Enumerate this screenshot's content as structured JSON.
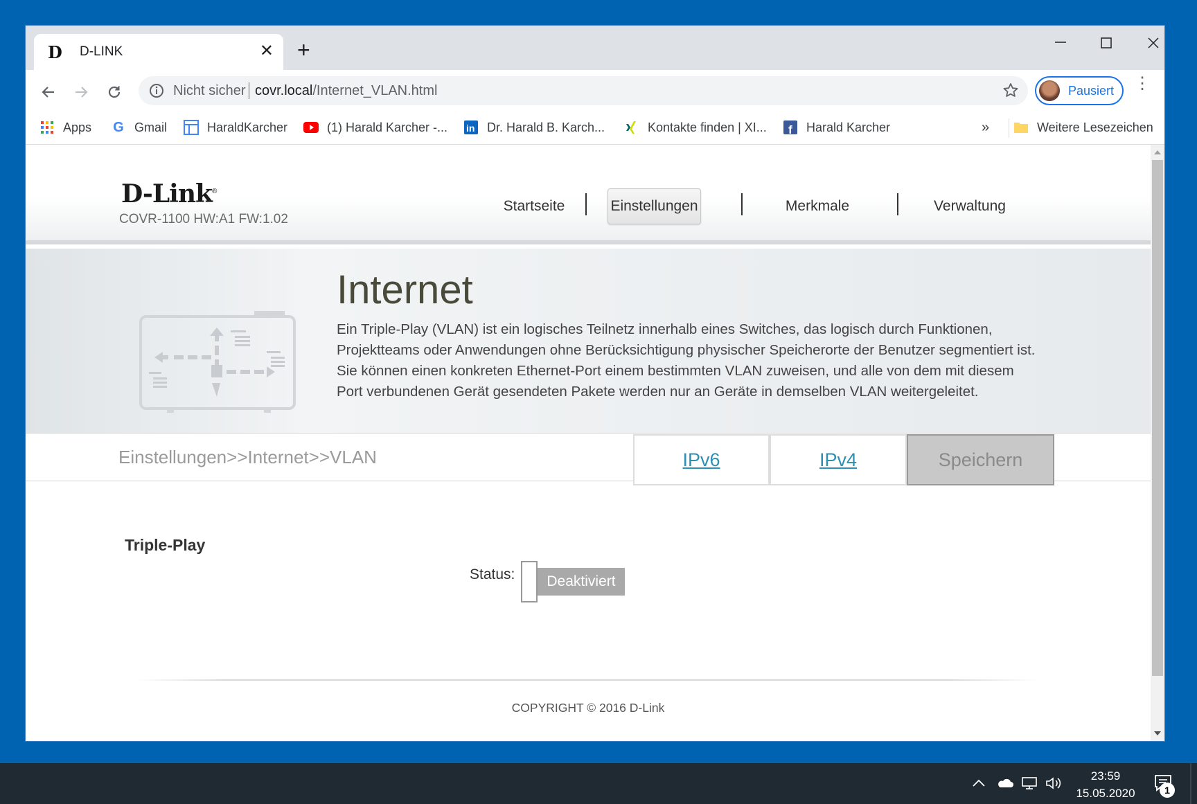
{
  "browser": {
    "tab_title": "D-LINK",
    "security_label": "Nicht sicher",
    "url_host": "covr.local",
    "url_path": "/Internet_VLAN.html",
    "profile_label": "Pausiert"
  },
  "bookmarks": {
    "items": [
      {
        "label": "Apps",
        "icon": "apps-grid-icon"
      },
      {
        "label": "Gmail",
        "icon": "google-icon"
      },
      {
        "label": "HaraldKarcher",
        "icon": "layout-icon"
      },
      {
        "label": "(1) Harald Karcher -...",
        "icon": "youtube-icon"
      },
      {
        "label": "Dr. Harald B. Karch...",
        "icon": "linkedin-icon"
      },
      {
        "label": "Kontakte finden | XI...",
        "icon": "xing-icon"
      },
      {
        "label": "Harald Karcher",
        "icon": "facebook-icon"
      }
    ],
    "overflow": "»",
    "other_label": "Weitere Lesezeichen"
  },
  "router": {
    "brand": "D-Link",
    "trademark": "®",
    "model": "COVR-1100 HW:A1 FW:1.02",
    "nav": [
      "Startseite",
      "Einstellungen",
      "Merkmale",
      "Verwaltung"
    ],
    "active_nav": "Einstellungen",
    "banner_title": "Internet",
    "banner_text": "Ein Triple-Play (VLAN) ist ein logisches Teilnetz innerhalb eines Switches, das logisch durch Funktionen, Projektteams oder Anwendungen ohne Berücksichtigung physischer Speicherorte der Benutzer segmentiert ist. Sie können einen konkreten Ethernet-Port einem bestimmten VLAN zuweisen, und alle von dem mit diesem Port verbundenen Gerät gesendeten Pakete werden nur an Geräte in demselben VLAN weitergeleitet.",
    "breadcrumb": "Einstellungen>>Internet>>VLAN",
    "btn_ipv6": "IPv6",
    "btn_ipv4": "IPv4",
    "btn_save": "Speichern",
    "section_title": "Triple-Play",
    "status_label": "Status:",
    "status_value": "Deaktiviert",
    "copyright": "COPYRIGHT © 2016 D-Link"
  },
  "taskbar": {
    "time": "23:59",
    "date": "15.05.2020",
    "notifications": "1"
  },
  "colors": {
    "desktop": "#0063b1",
    "accent_link": "#2f8fb3",
    "chrome_blue": "#1a73e8",
    "taskbar": "#1f2a33"
  }
}
